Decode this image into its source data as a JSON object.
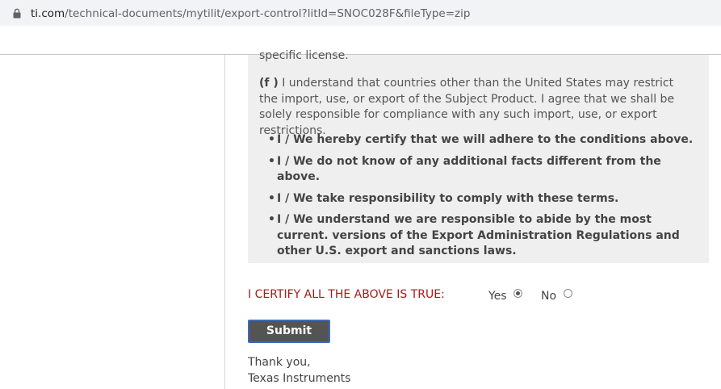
{
  "browser": {
    "url_domain": "ti.com",
    "url_path": "/technical-documents/mytilit/export-control?litId=SNOC028F&fileType=zip",
    "icon": "lock-icon"
  },
  "content": {
    "cut_text": "specific license.",
    "para_f_label": "(f )",
    "para_f_text": " I understand that countries other than the United States may restrict the import, use, or export of the Subject Product. I agree that we shall be solely responsible for compliance with any such import, use, or export restrictions.",
    "bullets": [
      "I / We hereby certify that we will adhere to the conditions above.",
      "I / We do not know of any additional facts different from the above.",
      "I / We take responsibility to comply with these terms.",
      "I / We understand we are responsible to abide by the most current. versions of the Export Administration Regulations and other U.S. export and sanctions laws."
    ],
    "bullet_glyph": "•"
  },
  "form": {
    "certify_label": "I CERTIFY ALL THE ABOVE IS TRUE:",
    "yes_label": "Yes",
    "no_label": "No",
    "selected": "Yes",
    "submit_label": "Submit"
  },
  "footer": {
    "line1": "Thank you,",
    "line2": "Texas Instruments"
  },
  "colors": {
    "accent_red": "#a31c1c",
    "panel_bg": "#efefef",
    "button_bg": "#545454",
    "button_border": "#3b6cb4"
  }
}
